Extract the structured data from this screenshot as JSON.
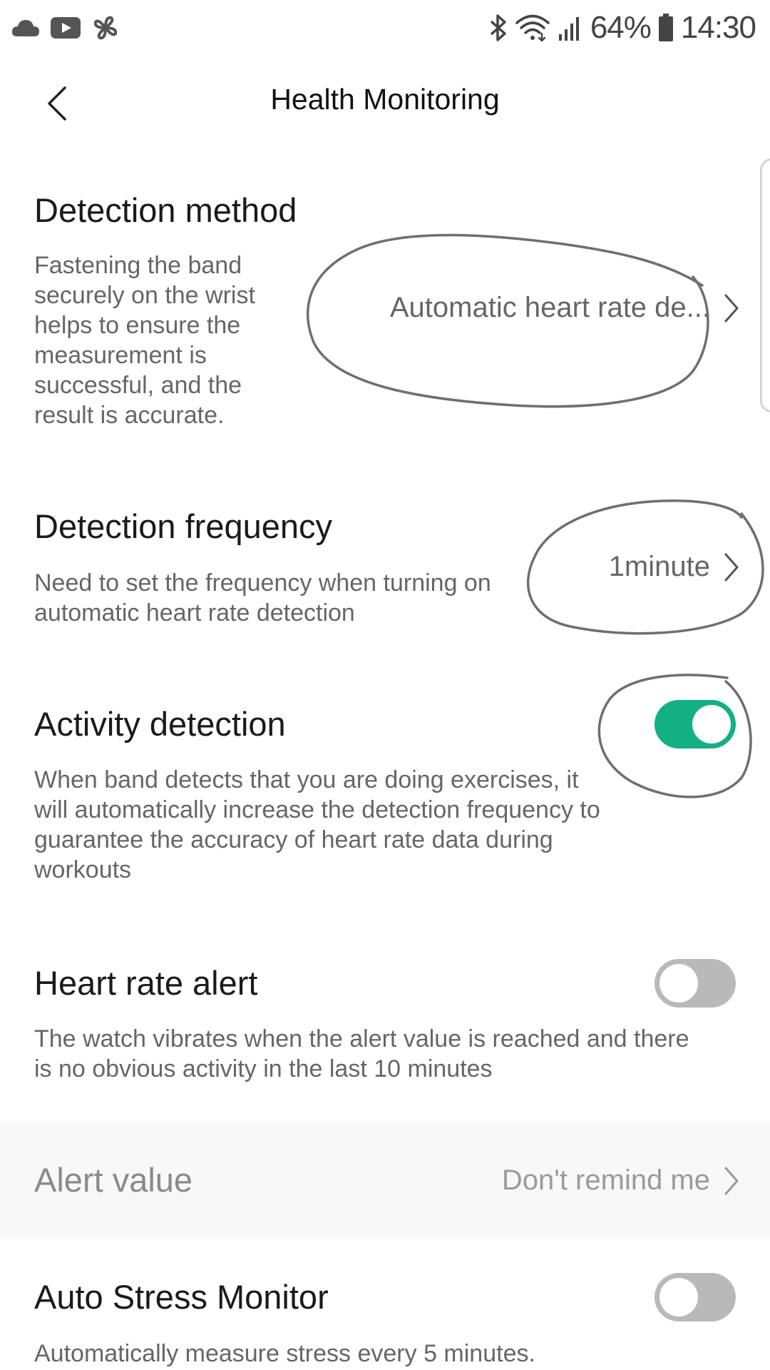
{
  "status_bar": {
    "left_icons": [
      "cloud-icon",
      "youtube-icon",
      "pinwheel-icon"
    ],
    "right_icons": [
      "bluetooth-icon",
      "wifi-icon",
      "signal-icon",
      "battery-icon"
    ],
    "battery": "64%",
    "time": "14:30"
  },
  "header": {
    "title": "Health Monitoring",
    "back_icon": "chevron-left-icon"
  },
  "settings": {
    "detection_method": {
      "title": "Detection method",
      "description": "Fastening the band securely on the wrist helps to ensure the measurement is successful, and the result is accurate.",
      "value": "Automatic heart rate de..."
    },
    "detection_frequency": {
      "title": "Detection frequency",
      "description": "Need to set the frequency when turning on automatic heart rate detection",
      "value": "1minute"
    },
    "activity_detection": {
      "title": "Activity detection",
      "description": "When band detects that you are doing exercises, it will automatically increase the detection frequency to guarantee the accuracy of heart rate data during workouts",
      "enabled": true
    },
    "heart_rate_alert": {
      "title": "Heart rate alert",
      "description": "The watch vibrates when the alert value is reached and there is no obvious activity in the last 10 minutes",
      "enabled": false
    },
    "alert_value": {
      "title": "Alert value",
      "value": "Don't remind me"
    },
    "auto_stress_monitor": {
      "title": "Auto Stress Monitor",
      "description": "Automatically measure stress every 5 minutes.",
      "enabled": false
    }
  },
  "colors": {
    "toggle_on": "#13b083",
    "toggle_off": "#b9b9b9",
    "annotation_stroke": "#6f6f6f"
  }
}
